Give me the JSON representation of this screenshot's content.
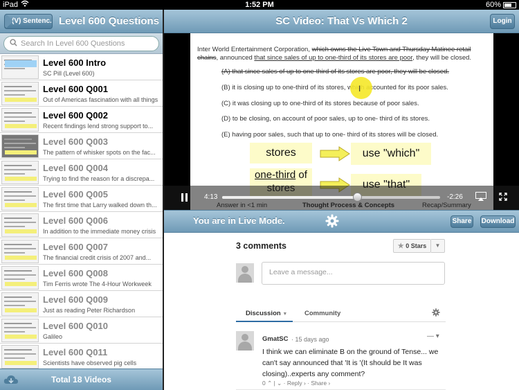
{
  "status_bar": {
    "carrier": "iPad",
    "time": "1:52 PM",
    "battery": "60%"
  },
  "left_panel": {
    "back_label": "(V) Sentenc...",
    "title": "Level 600 Questions",
    "search_placeholder": "Search In Level 600 Questions",
    "items": [
      {
        "title": "Level 600 Intro",
        "subtitle": "SC Pill (Level 600)",
        "watched": false
      },
      {
        "title": "Level 600 Q001",
        "subtitle": "Out of Americas fascination with all things",
        "watched": false
      },
      {
        "title": "Level 600 Q002",
        "subtitle": "Recent findings lend strong support to...",
        "watched": false
      },
      {
        "title": "Level 600 Q003",
        "subtitle": "The pattern of whisker spots on the fac...",
        "watched": true
      },
      {
        "title": "Level 600 Q004",
        "subtitle": "Trying to find the reason for a discrepa...",
        "watched": true
      },
      {
        "title": "Level 600 Q005",
        "subtitle": "The first time that Larry walked down th...",
        "watched": true
      },
      {
        "title": "Level 600 Q006",
        "subtitle": "In addition to the immediate money crisis",
        "watched": true
      },
      {
        "title": "Level 600 Q007",
        "subtitle": "The financial credit crisis of 2007 and...",
        "watched": true
      },
      {
        "title": "Level 600 Q008",
        "subtitle": "Tim Ferris wrote The 4-Hour Workweek",
        "watched": true
      },
      {
        "title": "Level 600 Q009",
        "subtitle": "Just as reading Peter Richardson",
        "watched": true
      },
      {
        "title": "Level 600 Q010",
        "subtitle": "Galileo",
        "watched": true
      },
      {
        "title": "Level 600 Q011",
        "subtitle": "Scientists have observed pig cells",
        "watched": true
      }
    ],
    "footer_total": "Total 18 Videos"
  },
  "right_panel": {
    "title": "SC Video: That Vs Which 2",
    "login_label": "Login",
    "slide": {
      "stem_plain": "Inter World Entertainment Corporation, ",
      "stem_struck": "which owns the Live Town and Thursday Matinee retail chains",
      "stem_mid": ", announced ",
      "stem_struck2": "that since sales of up to one-third of its stores are poor",
      "stem_end": ", they will be closed.",
      "choices": [
        "(A)  that since sales of up to one-third of its stores are poor, they will be closed.",
        "(B)  it is closing up to one-third of its stores, which accounted for its poor sales.",
        "(C)  it was closing up to one-third of its stores because of poor sales.",
        "(D)  to be closing, on account of poor sales, up to one- third of its stores.",
        "(E)  having poor sales, such that up to one- third of its stores will be closed."
      ],
      "box1_left": "stores",
      "box1_right": "use \"which\"",
      "box2_left_u": "one-third",
      "box2_left_rest": " of stores",
      "box2_right": "use \"that\""
    },
    "player": {
      "time_current": "4:13",
      "time_remaining": "-2:26",
      "progress_fraction": 0.62,
      "segments": [
        "Answer in <1 min",
        "Thought Process & Concepts",
        "Recap/Summary"
      ]
    },
    "live_label": "You are in Live Mode.",
    "share_label": "Share",
    "download_label": "Download",
    "comments": {
      "count_label": "3 comments",
      "stars_label": "0 Stars",
      "message_placeholder": "Leave a message...",
      "tab_discussion": "Discussion",
      "tab_community": "Community",
      "comment": {
        "author": "GmatSC",
        "date": "· 15 days ago",
        "text": "I think we can eliminate B on the ground of Tense... we can't say announced that 'It is '(It should be It was closing)..experts any comment?",
        "votes": "0",
        "reply": "Reply ›",
        "share": "Share ›"
      }
    }
  }
}
